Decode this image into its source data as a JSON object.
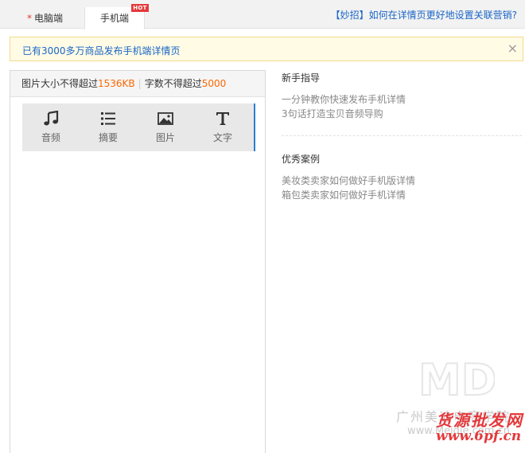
{
  "tabs": {
    "pc": {
      "required_mark": "*",
      "label": "电脑端"
    },
    "mobile": {
      "label": "手机端",
      "badge": "HOT"
    }
  },
  "tip_link": "【妙招】如何在详情页更好地设置关联营销?",
  "notice": {
    "text": "已有3000多万商品发布手机端详情页",
    "close_icon": "close-icon",
    "close_glyph": "×"
  },
  "editor": {
    "limit_image_prefix": "图片大小不得超过",
    "limit_image_value": "1536KB",
    "separator": "|",
    "limit_text_prefix": "字数不得超过",
    "limit_text_value": "5000",
    "tools": [
      {
        "icon": "music-note-icon",
        "label": "音频"
      },
      {
        "icon": "list-icon",
        "label": "摘要"
      },
      {
        "icon": "image-icon",
        "label": "图片"
      },
      {
        "icon": "text-t-icon",
        "label": "文字"
      }
    ],
    "active_accent": "#2a7fd4"
  },
  "guide": {
    "newbie_title": "新手指导",
    "newbie_links": [
      "一分钟教你快速发布手机详情",
      "3句话打造宝贝音频导购"
    ],
    "cases_title": "优秀案例",
    "cases_links": [
      "美妆类卖家如何做好手机版详情",
      "箱包类卖家如何做好手机详情"
    ]
  },
  "watermark": {
    "logo_text": "MD",
    "line1": "广州美迪电商学院",
    "line2": "www.Meidie.com.cn",
    "overlay1": "货源批发网",
    "overlay2": "www.6pf.cn"
  },
  "colors": {
    "link": "#1a66c7",
    "highlight": "#ff6600",
    "hot": "#e4393c"
  }
}
